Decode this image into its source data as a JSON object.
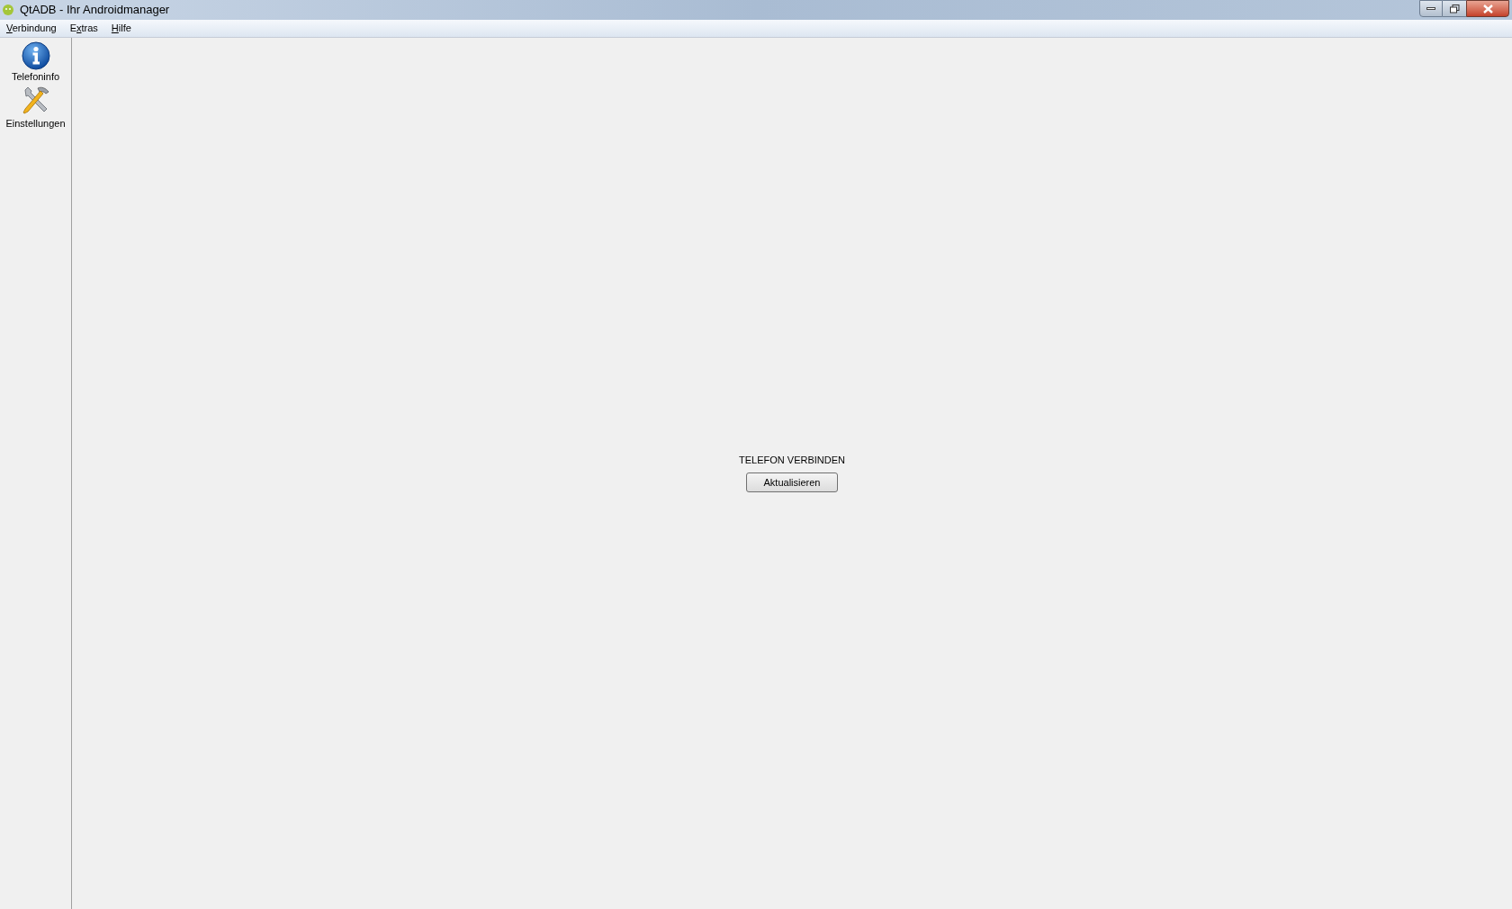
{
  "window": {
    "title": "QtADB - Ihr Androidmanager"
  },
  "menu": [
    {
      "key": "V",
      "post": "erbindung"
    },
    {
      "pre": "E",
      "key": "x",
      "post": "tras"
    },
    {
      "key": "H",
      "post": "ilfe"
    }
  ],
  "sidebar": {
    "items": [
      {
        "kind": "info",
        "label": "Telefoninfo"
      },
      {
        "kind": "tools",
        "label": "Einstellungen"
      }
    ]
  },
  "main": {
    "message": "TELEFON VERBINDEN",
    "button": "Aktualisieren"
  }
}
